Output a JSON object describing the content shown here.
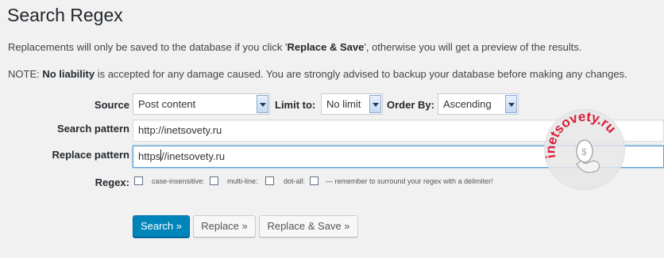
{
  "page": {
    "title": "Search Regex",
    "intro_pre": "Replacements will only be saved to the database if you click '",
    "intro_bold": "Replace & Save",
    "intro_post": "', otherwise you will get a preview of the results.",
    "note_pre": "NOTE: ",
    "note_bold": "No liability",
    "note_post": " is accepted for any damage caused. You are strongly advised to backup your database before making any changes."
  },
  "form": {
    "source_label": "Source",
    "source_value": "Post content",
    "limit_label": "Limit to:",
    "limit_value": "No limit",
    "order_label": "Order By:",
    "order_value": "Ascending",
    "search_label": "Search pattern",
    "search_value": "http://inetsovety.ru",
    "replace_label": "Replace pattern",
    "replace_value_before_caret": "https",
    "replace_value_after_caret": "//inetsovety.ru",
    "regex_label": "Regex:",
    "opt_case": "case-insensitive:",
    "opt_multiline": "multi-line:",
    "opt_dotall": "dot-all:",
    "opt_note": "— remember to surround your regex with a delimiter!"
  },
  "buttons": {
    "search": "Search »",
    "replace": "Replace »",
    "replace_save": "Replace & Save »"
  },
  "watermark": {
    "text": "inetsovety.ru",
    "icon": "mouse-dollar-icon"
  }
}
